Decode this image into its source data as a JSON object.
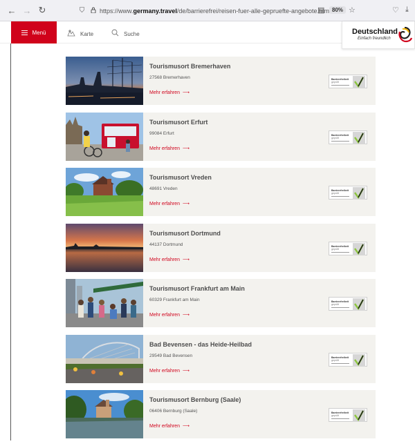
{
  "browser": {
    "url_prefix": "https://www.",
    "url_domain": "germany.travel",
    "url_path": "/de/barrierefrei/reisen-fuer-alle-gepruefte-angebote.html",
    "zoom": "80%"
  },
  "header": {
    "menu_label": "Menü",
    "map_label": "Karte",
    "search_label": "Suche",
    "brand_name": "Deutschland",
    "brand_tagline": "Einfach freundlich"
  },
  "cards": [
    {
      "title": "Tourismusort Bremerhaven",
      "address": "27568 Bremerhaven",
      "link": "Mehr erfahren",
      "scene": "harbor-night"
    },
    {
      "title": "Tourismusort Erfurt",
      "address": "99084 Erfurt",
      "link": "Mehr erfahren",
      "scene": "tram-square"
    },
    {
      "title": "Tourismusort Vreden",
      "address": "48691 Vreden",
      "link": "Mehr erfahren",
      "scene": "castle-meadow"
    },
    {
      "title": "Tourismusort Dortmund",
      "address": "44137 Dortmund",
      "link": "Mehr erfahren",
      "scene": "sunset-lake"
    },
    {
      "title": "Tourismusort Frankfurt am Main",
      "address": "60329 Frankfurt am Main",
      "link": "Mehr erfahren",
      "scene": "group-bridge"
    },
    {
      "title": "Bad Bevensen - das Heide-Heilbad",
      "address": "29549 Bad Bevensen",
      "link": "Mehr erfahren",
      "scene": "spa-garden"
    },
    {
      "title": "Tourismusort Bernburg (Saale)",
      "address": "06406 Bernburg (Saale)",
      "link": "Mehr erfahren",
      "scene": "river-castle"
    }
  ],
  "badge": {
    "title": "Barrierefreiheit",
    "subtitle": "geprüft"
  },
  "colors": {
    "accent": "#d0021b",
    "card_bg": "#f3f2ee",
    "check_green": "#8dc63f"
  }
}
